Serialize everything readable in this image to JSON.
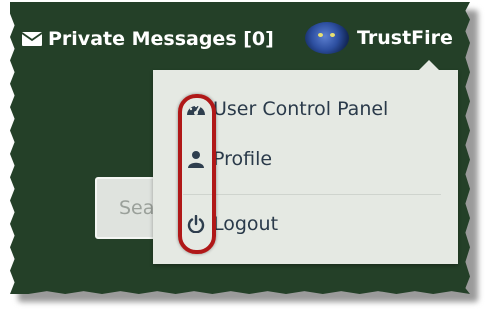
{
  "nav": {
    "private_messages_label": "Private Messages [0]",
    "username": "TrustFire"
  },
  "search": {
    "placeholder": "Sea"
  },
  "dropdown": {
    "items": [
      {
        "label": "User Control Panel",
        "icon": "dashboard-icon"
      },
      {
        "label": "Profile",
        "icon": "user-icon"
      },
      {
        "label": "Logout",
        "icon": "power-icon"
      }
    ]
  },
  "colors": {
    "background": "#244028",
    "dropdown": "#e5e9e3",
    "highlight": "#b01818"
  }
}
